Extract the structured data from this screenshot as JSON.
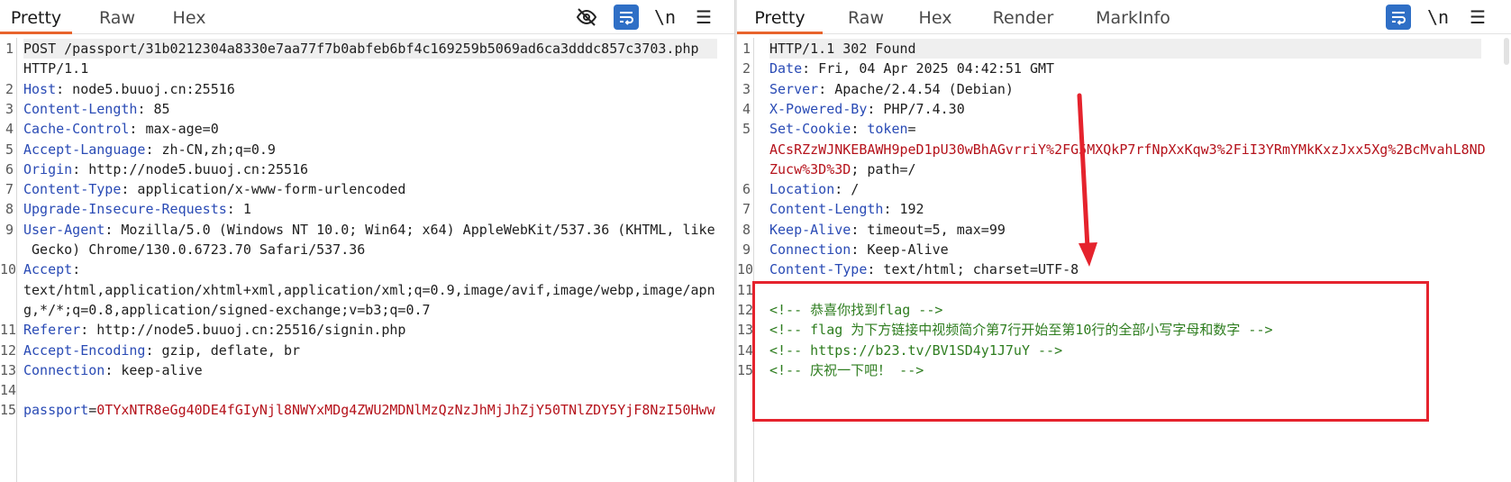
{
  "request": {
    "tabs": [
      "Pretty",
      "Raw",
      "Hex"
    ],
    "tools": {
      "hide": "eye-slash-icon",
      "wrap": "wrap-icon",
      "newline": "\\n",
      "menu": "☰"
    },
    "lines": [
      {
        "num": "1",
        "parts": [
          {
            "t": "POST /passport/31b0212304a8330e7aa77f7b0abfeb6bf4c169259b5069ad6ca3dddc857c3703.php",
            "c": "hv"
          }
        ]
      },
      {
        "num": "",
        "parts": [
          {
            "t": "HTTP/1.1",
            "c": "hv"
          }
        ]
      },
      {
        "num": "2",
        "parts": [
          {
            "t": "Host",
            "c": "hk"
          },
          {
            "t": ": node5.buuoj.cn:25516",
            "c": "hv"
          }
        ]
      },
      {
        "num": "3",
        "parts": [
          {
            "t": "Content-Length",
            "c": "hk"
          },
          {
            "t": ": 85",
            "c": "hv"
          }
        ]
      },
      {
        "num": "4",
        "parts": [
          {
            "t": "Cache-Control",
            "c": "hk"
          },
          {
            "t": ": max-age=0",
            "c": "hv"
          }
        ]
      },
      {
        "num": "5",
        "parts": [
          {
            "t": "Accept-Language",
            "c": "hk"
          },
          {
            "t": ": zh-CN,zh;q=0.9",
            "c": "hv"
          }
        ]
      },
      {
        "num": "6",
        "parts": [
          {
            "t": "Origin",
            "c": "hk"
          },
          {
            "t": ": http://node5.buuoj.cn:25516",
            "c": "hv"
          }
        ]
      },
      {
        "num": "7",
        "parts": [
          {
            "t": "Content-Type",
            "c": "hk"
          },
          {
            "t": ": application/x-www-form-urlencoded",
            "c": "hv"
          }
        ]
      },
      {
        "num": "8",
        "parts": [
          {
            "t": "Upgrade-Insecure-Requests",
            "c": "hk"
          },
          {
            "t": ": 1",
            "c": "hv"
          }
        ]
      },
      {
        "num": "9",
        "parts": [
          {
            "t": "User-Agent",
            "c": "hk"
          },
          {
            "t": ": Mozilla/5.0 (Windows NT 10.0; Win64; x64) AppleWebKit/537.36 (KHTML, like",
            "c": "hv"
          }
        ]
      },
      {
        "num": "",
        "parts": [
          {
            "t": " Gecko) Chrome/130.0.6723.70 Safari/537.36",
            "c": "hv"
          }
        ]
      },
      {
        "num": "10",
        "parts": [
          {
            "t": "Accept",
            "c": "hk"
          },
          {
            "t": ":",
            "c": "hv"
          }
        ]
      },
      {
        "num": "",
        "parts": [
          {
            "t": "text/html,application/xhtml+xml,application/xml;q=0.9,image/avif,image/webp,image/apn",
            "c": "hv"
          }
        ]
      },
      {
        "num": "",
        "parts": [
          {
            "t": "g,*/*;q=0.8,application/signed-exchange;v=b3;q=0.7",
            "c": "hv"
          }
        ]
      },
      {
        "num": "11",
        "parts": [
          {
            "t": "Referer",
            "c": "hk"
          },
          {
            "t": ": http://node5.buuoj.cn:25516/signin.php",
            "c": "hv"
          }
        ]
      },
      {
        "num": "12",
        "parts": [
          {
            "t": "Accept-Encoding",
            "c": "hk"
          },
          {
            "t": ": gzip, deflate, br",
            "c": "hv"
          }
        ]
      },
      {
        "num": "13",
        "parts": [
          {
            "t": "Connection",
            "c": "hk"
          },
          {
            "t": ": keep-alive",
            "c": "hv"
          }
        ]
      },
      {
        "num": "14",
        "parts": []
      },
      {
        "num": "15",
        "parts": [
          {
            "t": "passport",
            "c": "hk"
          },
          {
            "t": "=",
            "c": "hv"
          },
          {
            "t": "0TYxNTR8eGg40DE4fGIyNjl8NWYxMDg4ZWU2MDNlMzQzNzJhMjJhZjY50TNlZDY5YjF8NzI50Hww",
            "c": "red"
          }
        ]
      }
    ]
  },
  "response": {
    "tabs": [
      "Pretty",
      "Raw",
      "Hex",
      "Render",
      "MarkInfo"
    ],
    "tools": {
      "wrap": "wrap-icon",
      "newline": "\\n",
      "menu": "☰"
    },
    "lines": [
      {
        "num": "1",
        "parts": [
          {
            "t": "HTTP/1.1 302 Found",
            "c": "hv"
          }
        ]
      },
      {
        "num": "2",
        "parts": [
          {
            "t": "Date",
            "c": "hk"
          },
          {
            "t": ": Fri, 04 Apr 2025 04:42:51 GMT",
            "c": "hv"
          }
        ]
      },
      {
        "num": "3",
        "parts": [
          {
            "t": "Server",
            "c": "hk"
          },
          {
            "t": ": Apache/2.4.54 (Debian)",
            "c": "hv"
          }
        ]
      },
      {
        "num": "4",
        "parts": [
          {
            "t": "X-Powered-By",
            "c": "hk"
          },
          {
            "t": ": PHP/7.4.30",
            "c": "hv"
          }
        ]
      },
      {
        "num": "5",
        "parts": [
          {
            "t": "Set-Cookie",
            "c": "hk"
          },
          {
            "t": ": ",
            "c": "hv"
          },
          {
            "t": "token",
            "c": "hk"
          },
          {
            "t": "=",
            "c": "hv"
          }
        ]
      },
      {
        "num": "",
        "parts": [
          {
            "t": "ACsRZzWJNKEBAWH9peD1pU30wBhAGvrriY%2FG5MXQkP7rfNpXxKqw3%2FiI3YRmYMkKxzJxx5Xg%2BcMvahL8ND",
            "c": "red"
          }
        ]
      },
      {
        "num": "",
        "parts": [
          {
            "t": "Zucw%3D%3D",
            "c": "red"
          },
          {
            "t": "; path=/",
            "c": "hv"
          }
        ]
      },
      {
        "num": "6",
        "parts": [
          {
            "t": "Location",
            "c": "hk"
          },
          {
            "t": ": /",
            "c": "hv"
          }
        ]
      },
      {
        "num": "7",
        "parts": [
          {
            "t": "Content-Length",
            "c": "hk"
          },
          {
            "t": ": 192",
            "c": "hv"
          }
        ]
      },
      {
        "num": "8",
        "parts": [
          {
            "t": "Keep-Alive",
            "c": "hk"
          },
          {
            "t": ": timeout=5, max=99",
            "c": "hv"
          }
        ]
      },
      {
        "num": "9",
        "parts": [
          {
            "t": "Connection",
            "c": "hk"
          },
          {
            "t": ": Keep-Alive",
            "c": "hv"
          }
        ]
      },
      {
        "num": "10",
        "parts": [
          {
            "t": "Content-Type",
            "c": "hk"
          },
          {
            "t": ": text/html; charset=UTF-8",
            "c": "hv"
          }
        ]
      },
      {
        "num": "11",
        "parts": []
      },
      {
        "num": "12",
        "parts": [
          {
            "t": "<!-- 恭喜你找到flag -->",
            "c": "green"
          }
        ]
      },
      {
        "num": "13",
        "parts": [
          {
            "t": "<!-- flag 为下方链接中视频简介第7行开始至第10行的全部小写字母和数字 -->",
            "c": "green"
          }
        ]
      },
      {
        "num": "14",
        "parts": [
          {
            "t": "<!-- https://b23.tv/BV1SD4y1J7uY -->",
            "c": "green"
          }
        ]
      },
      {
        "num": "15",
        "parts": [
          {
            "t": "<!-- 庆祝一下吧！ -->",
            "c": "green"
          }
        ]
      }
    ]
  },
  "colors": {
    "accent": "#e8642c",
    "annotation": "#e5232d",
    "header_key": "#2a4bb5",
    "value_red": "#b5121b",
    "comment_green": "#2e7d1f"
  }
}
